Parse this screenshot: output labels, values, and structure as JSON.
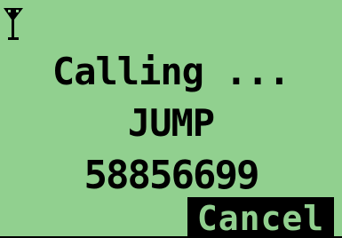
{
  "screen": {
    "background": "#91d08f",
    "signal_icon": "antenna-signal-icon",
    "call_status": "Calling ...",
    "contact_name": "JUMP",
    "phone_number": "58856699"
  },
  "softkeys": {
    "right_label": "Cancel"
  }
}
